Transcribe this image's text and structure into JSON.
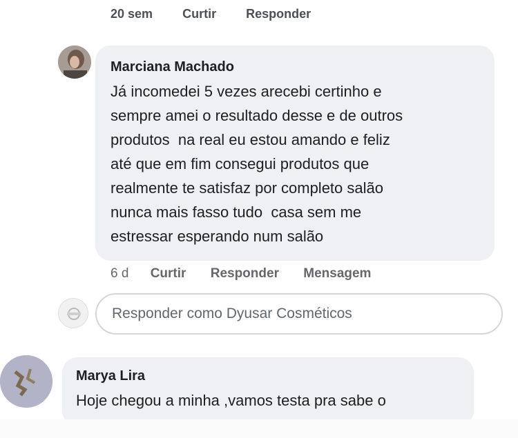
{
  "previous_comment": {
    "actions_partial": [
      "20 sem",
      "Curtir",
      "Responder"
    ]
  },
  "comment1": {
    "author": "Marciana Machado",
    "text": "Já incomedei 5 vezes arecebi certinho e\nsempre amei o resultado desse e de outros\nprodutos  na real eu estou amando e feliz\naté que em fim consegui produtos que\nrealmente te satisfaz por completo salão\nnunca mais fasso tudo  casa sem me\nestressar esperando num salão",
    "time": "6 d",
    "actions": [
      "Curtir",
      "Responder",
      "Mensagem"
    ]
  },
  "reply_box": {
    "placeholder": "Responder como Dyusar Cosméticos"
  },
  "comment2": {
    "author": "Marya Lira",
    "text": "Hoje chegou a minha ,vamos testa pra sabe o"
  }
}
